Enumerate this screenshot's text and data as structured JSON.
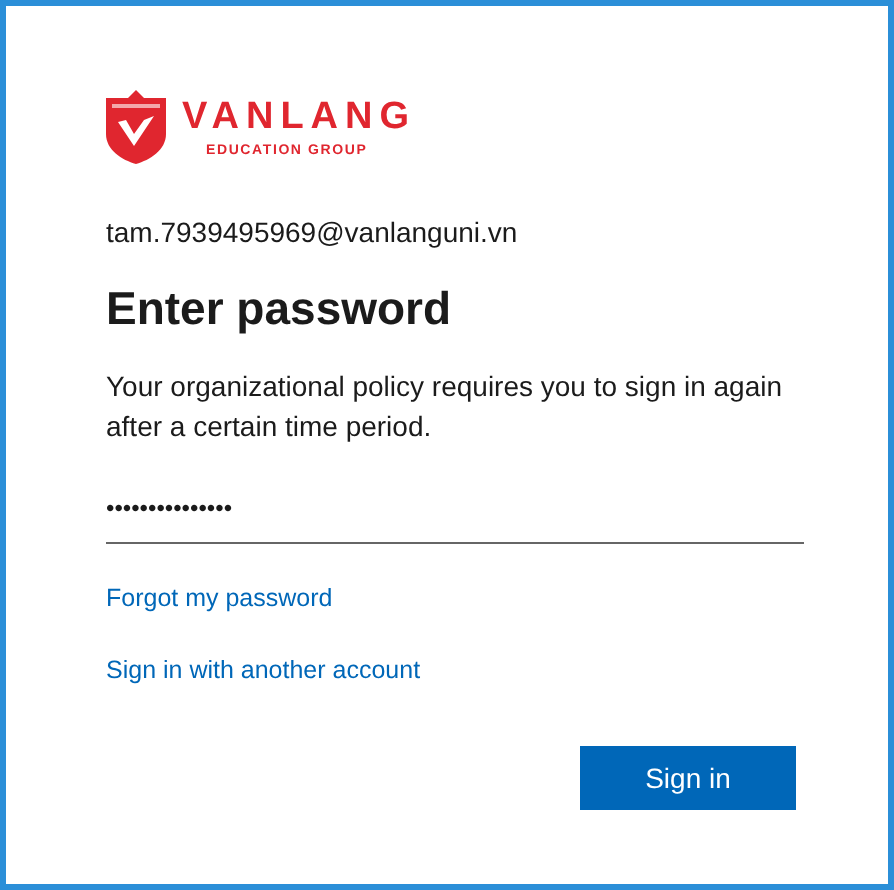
{
  "logo": {
    "name": "VANLANG",
    "tagline": "EDUCATION GROUP"
  },
  "account": "tam.7939495969@vanlanguni.vn",
  "title": "Enter password",
  "message": "Your organizational policy requires you to sign in again after a certain time period.",
  "password": {
    "value": "•••••••••••••••"
  },
  "links": [
    "Forgot my password",
    "Sign in with another account"
  ],
  "button": "Sign in"
}
